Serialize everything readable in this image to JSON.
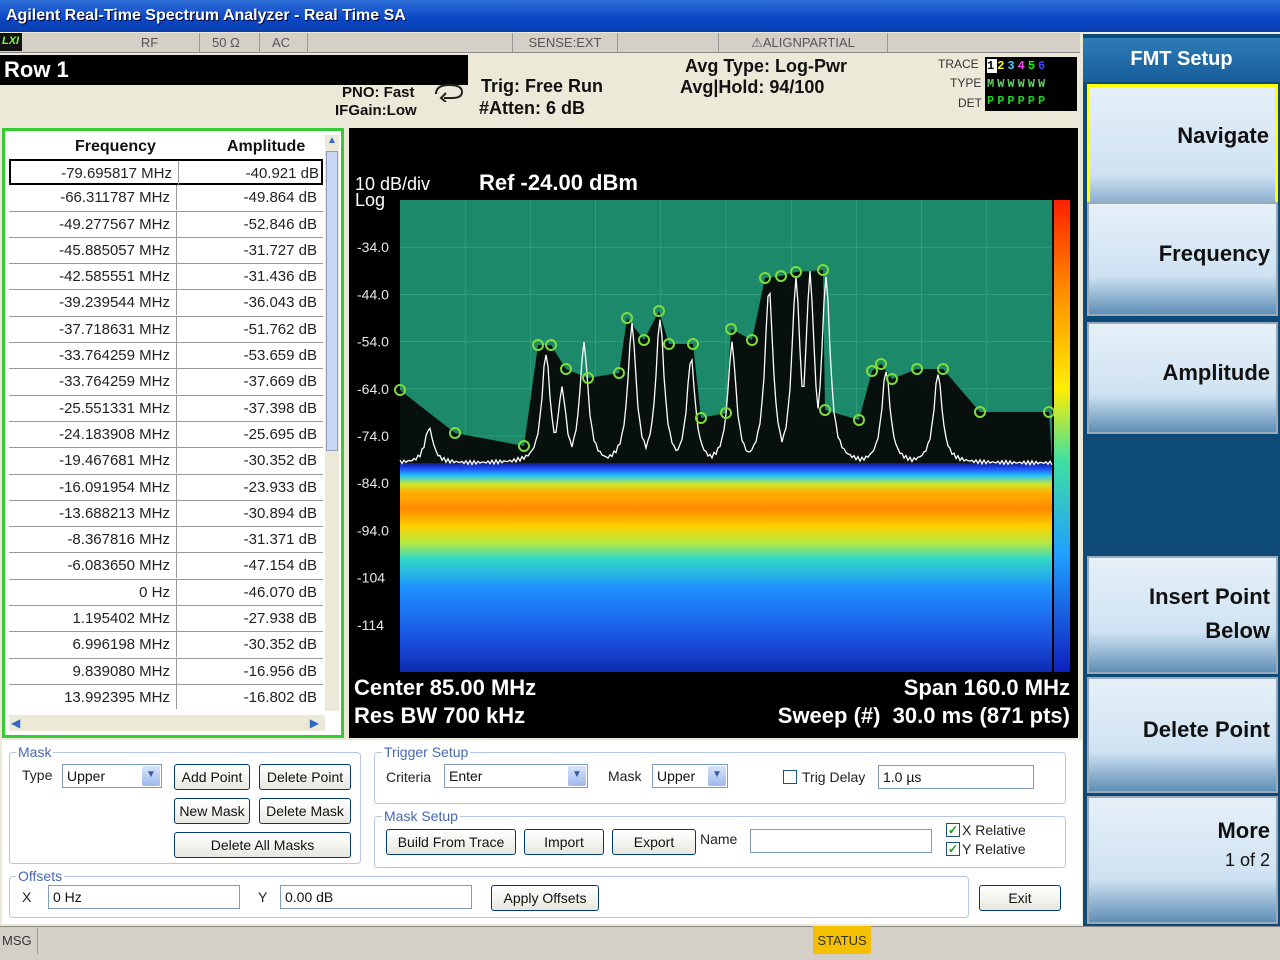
{
  "window": {
    "title": "Agilent Real-Time Spectrum Analyzer - Real Time SA"
  },
  "status_strip": {
    "logo": "LXI",
    "items": [
      "RF",
      "50 Ω",
      "AC",
      "SENSE:EXT",
      "⚠ALIGNPARTIAL"
    ]
  },
  "header": {
    "row_title": "Row 1",
    "pno": "PNO: Fast",
    "ifgain": "IFGain:Low",
    "trig": "Trig: Free Run",
    "atten": "#Atten: 6 dB",
    "avg_type": "Avg Type: Log-Pwr",
    "avg_hold": "Avg|Hold: 94/100",
    "trace_label": "TRACE",
    "type_label": "TYPE",
    "det_label": "DET",
    "trace_digits": "123456",
    "trace_type": "MWWWWW",
    "trace_det": "PPPPPP"
  },
  "table": {
    "headers": {
      "frequency": "Frequency",
      "amplitude": "Amplitude"
    },
    "rows": [
      {
        "frequency": "-79.695817 MHz",
        "amplitude": "-40.921 dB"
      },
      {
        "frequency": "-66.311787 MHz",
        "amplitude": "-49.864 dB"
      },
      {
        "frequency": "-49.277567 MHz",
        "amplitude": "-52.846 dB"
      },
      {
        "frequency": "-45.885057 MHz",
        "amplitude": "-31.727 dB"
      },
      {
        "frequency": "-42.585551 MHz",
        "amplitude": "-31.436 dB"
      },
      {
        "frequency": "-39.239544 MHz",
        "amplitude": "-36.043 dB"
      },
      {
        "frequency": "-37.718631 MHz",
        "amplitude": "-51.762 dB"
      },
      {
        "frequency": "-33.764259 MHz",
        "amplitude": "-53.659 dB"
      },
      {
        "frequency": "-33.764259 MHz",
        "amplitude": "-37.669 dB"
      },
      {
        "frequency": "-25.551331 MHz",
        "amplitude": "-37.398 dB"
      },
      {
        "frequency": "-24.183908 MHz",
        "amplitude": "-25.695 dB"
      },
      {
        "frequency": "-19.467681 MHz",
        "amplitude": "-30.352 dB"
      },
      {
        "frequency": "-16.091954 MHz",
        "amplitude": "-23.933 dB"
      },
      {
        "frequency": "-13.688213 MHz",
        "amplitude": "-30.894 dB"
      },
      {
        "frequency": "-8.367816 MHz",
        "amplitude": "-31.371 dB"
      },
      {
        "frequency": "-6.083650 MHz",
        "amplitude": "-47.154 dB"
      },
      {
        "frequency": "0 Hz",
        "amplitude": "-46.070 dB"
      },
      {
        "frequency": "1.195402 MHz",
        "amplitude": "-27.938 dB"
      },
      {
        "frequency": "6.996198 MHz",
        "amplitude": "-30.352 dB"
      },
      {
        "frequency": "9.839080 MHz",
        "amplitude": "-16.956 dB"
      },
      {
        "frequency": "13.992395 MHz",
        "amplitude": "-16.802 dB"
      }
    ]
  },
  "plot": {
    "scale": "10 dB/div",
    "scale_type": "Log",
    "ref": "Ref -24.00 dBm",
    "center": "Center 85.00 MHz",
    "res_bw": "Res BW 700 kHz",
    "span": "Span 160.0 MHz",
    "sweep": "Sweep (#)  30.0 ms (871 pts)",
    "y_ticks": [
      "-34.0",
      "-44.0",
      "-54.0",
      "-64.0",
      "-74.0",
      "-84.0",
      "-94.0",
      "-104",
      "-114"
    ],
    "colors": {
      "mask_fill": "#1c8a6a",
      "trace": "#ffffff",
      "marker": "#7fdc3a"
    }
  },
  "softkeys": {
    "title": "FMT Setup",
    "keys": [
      {
        "label": "Navigate"
      },
      {
        "label": "Frequency"
      },
      {
        "label": "Amplitude"
      },
      {
        "label": "Insert Point Below"
      },
      {
        "label": "Delete Point"
      },
      {
        "label": "More",
        "sub": "1 of 2"
      }
    ]
  },
  "controls": {
    "mask": {
      "group_label": "Mask",
      "type_label": "Type",
      "type_value": "Upper",
      "add_point": "Add Point",
      "delete_point": "Delete Point",
      "new_mask": "New Mask",
      "delete_mask": "Delete Mask",
      "delete_all": "Delete All Masks"
    },
    "trigger": {
      "group_label": "Trigger Setup",
      "criteria_label": "Criteria",
      "criteria_value": "Enter",
      "mask_label": "Mask",
      "mask_value": "Upper",
      "trig_delay_label": "Trig Delay",
      "trig_delay_value": "1.0 µs"
    },
    "mask_setup": {
      "group_label": "Mask Setup",
      "build": "Build From Trace",
      "import": "Import",
      "export": "Export",
      "name_label": "Name",
      "name_value": "",
      "x_relative": "X Relative",
      "y_relative": "Y Relative"
    },
    "offsets": {
      "group_label": "Offsets",
      "x_label": "X",
      "x_value": "0 Hz",
      "y_label": "Y",
      "y_value": "0.00 dB",
      "apply": "Apply Offsets"
    },
    "exit": "Exit"
  },
  "message_bar": {
    "msg": "MSG",
    "status": "STATUS"
  }
}
